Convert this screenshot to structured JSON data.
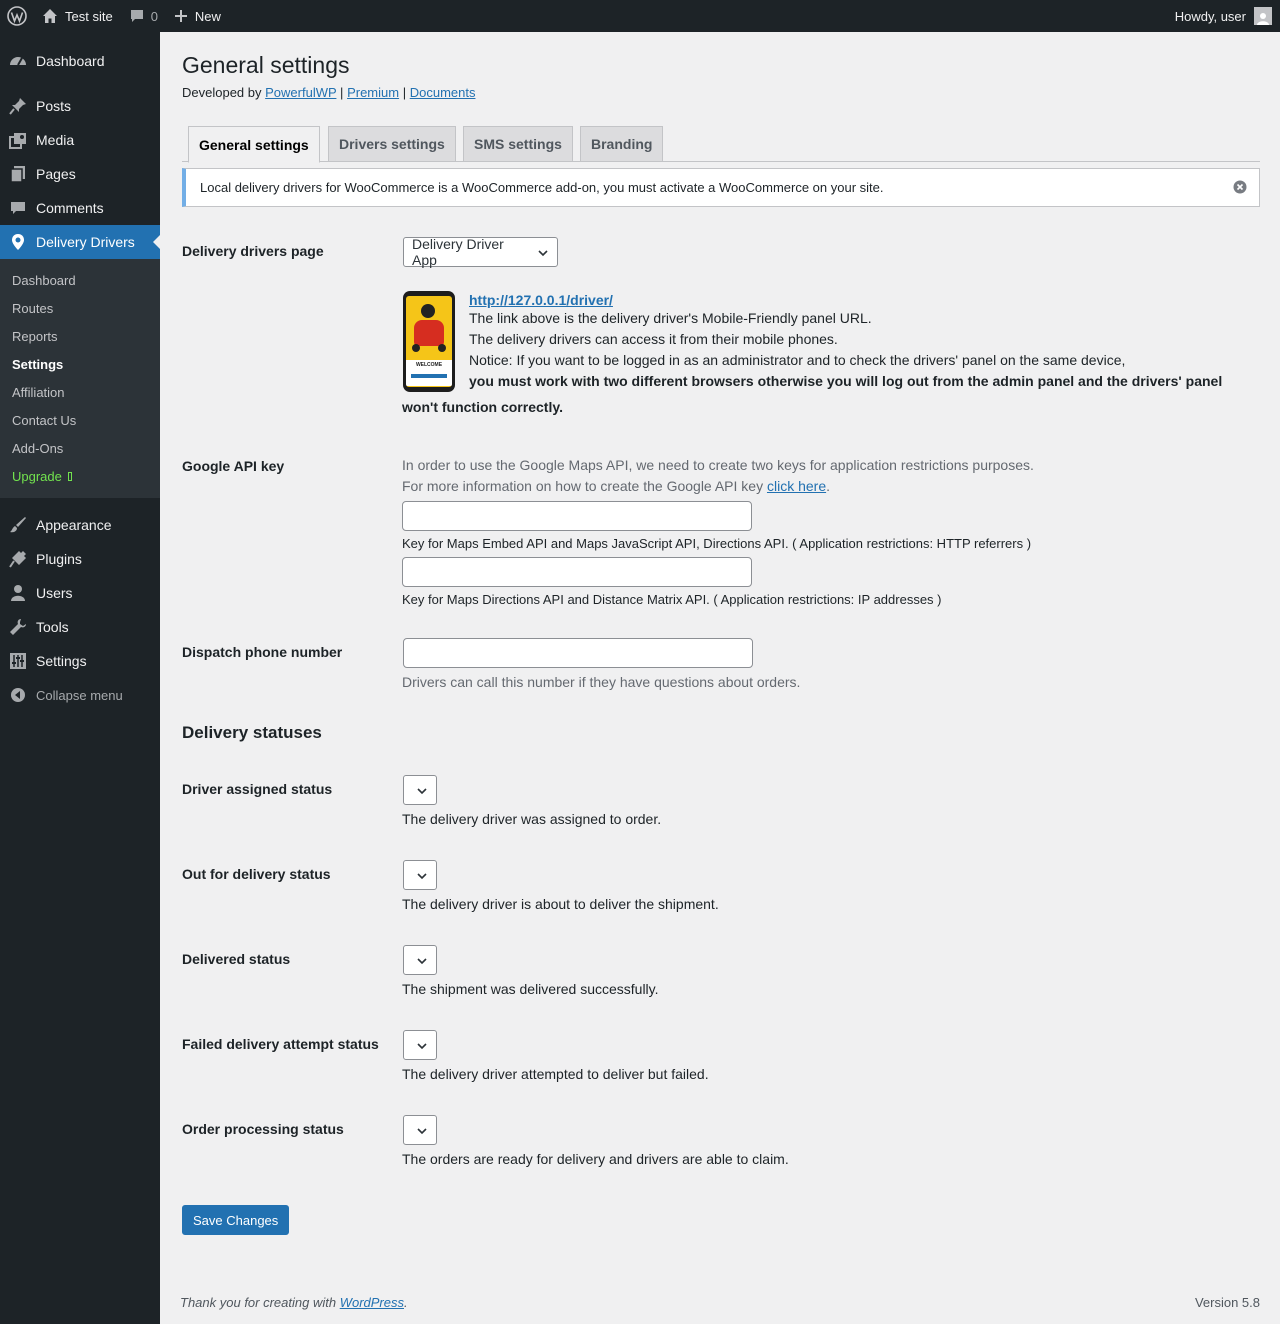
{
  "adminbar": {
    "site_name": "Test site",
    "comments_count": "0",
    "new_label": "New",
    "howdy": "Howdy, user"
  },
  "menu": {
    "items_top": [
      {
        "label": "Dashboard",
        "icon": "dashboard-icon"
      },
      {
        "label": "Posts",
        "icon": "pin-icon"
      },
      {
        "label": "Media",
        "icon": "media-icon"
      },
      {
        "label": "Pages",
        "icon": "pages-icon"
      },
      {
        "label": "Comments",
        "icon": "comment-icon"
      }
    ],
    "current": {
      "label": "Delivery Drivers",
      "icon": "location-pin-icon"
    },
    "submenu": [
      "Dashboard",
      "Routes",
      "Reports",
      "Settings",
      "Affiliation",
      "Contact Us",
      "Add-Ons",
      "Upgrade"
    ],
    "items_bottom": [
      {
        "label": "Appearance",
        "icon": "brush-icon"
      },
      {
        "label": "Plugins",
        "icon": "plugin-icon"
      },
      {
        "label": "Users",
        "icon": "user-icon"
      },
      {
        "label": "Tools",
        "icon": "wrench-icon"
      },
      {
        "label": "Settings",
        "icon": "sliders-icon"
      }
    ],
    "collapse": "Collapse menu"
  },
  "page": {
    "title": "General settings",
    "developed_by": "Developed by",
    "links": [
      "PowerfulWP",
      "Premium",
      "Documents"
    ],
    "separator": "|"
  },
  "tabs": [
    "General settings",
    "Drivers settings",
    "SMS settings",
    "Branding"
  ],
  "notice": "Local delivery drivers for WooCommerce is a WooCommerce add-on, you must activate a WooCommerce on your site.",
  "drivers_page": {
    "label": "Delivery drivers page",
    "selected": "Delivery Driver App",
    "url": "http://127.0.0.1/driver/",
    "line1": "The link above is the delivery driver's Mobile-Friendly panel URL.",
    "line2": "The delivery drivers can access it from their mobile phones.",
    "line3": "Notice: If you want to be logged in as an administrator and to check the drivers' panel on the same device,",
    "bold_a": "you must work with two different browsers otherwise you will log out from the admin panel and the drivers' panel",
    "bold_b": "won't function correctly.",
    "phone_screen_text": "WELCOME"
  },
  "google_api": {
    "label": "Google API key",
    "intro1": "In order to use the Google Maps API, we need to create two keys for application restrictions purposes.",
    "intro2": "For more information on how to create the Google API key",
    "link": "click here",
    "period": ".",
    "key1_value": "",
    "key1_desc": "Key for Maps Embed API and Maps JavaScript API, Directions API. ( Application restrictions: HTTP referrers )",
    "key2_value": "",
    "key2_desc": "Key for Maps Directions API and Distance Matrix API. ( Application restrictions: IP addresses )"
  },
  "dispatch": {
    "label": "Dispatch phone number",
    "value": "",
    "desc": "Drivers can call this number if they have questions about orders."
  },
  "statuses_heading": "Delivery statuses",
  "statuses": [
    {
      "label": "Driver assigned status",
      "desc": "The delivery driver was assigned to order."
    },
    {
      "label": "Out for delivery status",
      "desc": "The delivery driver is about to deliver the shipment."
    },
    {
      "label": "Delivered status",
      "desc": "The shipment was delivered successfully."
    },
    {
      "label": "Failed delivery attempt status",
      "desc": "The delivery driver attempted to deliver but failed."
    },
    {
      "label": "Order processing status",
      "desc": "The orders are ready for delivery and drivers are able to claim."
    }
  ],
  "save_label": "Save Changes",
  "footer": {
    "thanks": "Thank you for creating with",
    "wp_link": "WordPress",
    "period": ".",
    "version": "Version 5.8"
  },
  "colors": {
    "adminbar_bg": "#1d2327",
    "menu_current": "#2271b1",
    "notice_border": "#72aee6",
    "upgrade": "#72e34e"
  }
}
